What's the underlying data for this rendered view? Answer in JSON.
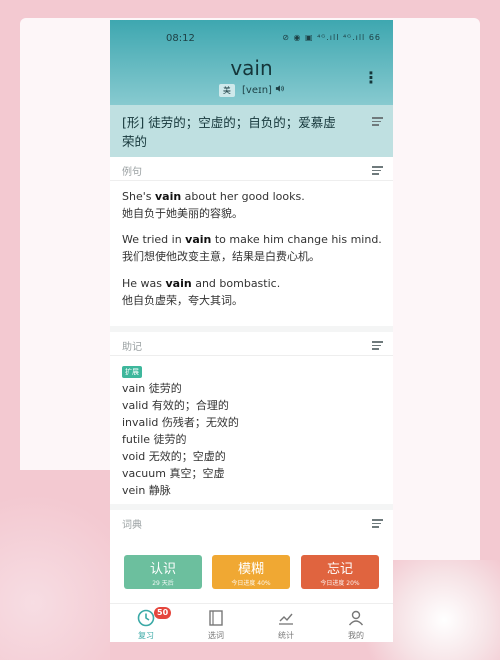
{
  "status": {
    "time": "08:12",
    "icons": "⊘ ◉ ▣ ⁴ᴳ.ıll ⁴ᴳ.ıll 66"
  },
  "word": {
    "text": "vain",
    "region": "美",
    "ipa": "[veɪn]",
    "audio_icon": "speaker-icon"
  },
  "definition": "[形] 徒劳的；空虚的；自负的；爱慕虚荣的",
  "examples": {
    "label": "例句",
    "items": [
      {
        "en_pre": "She's ",
        "en_word": "vain",
        "en_post": " about her good looks.",
        "zh": "她自负于她美丽的容貌。"
      },
      {
        "en_pre": "We tried in ",
        "en_word": "vain",
        "en_post": " to make him change his mind.",
        "zh": "我们想使他改变主意，结果是白费心机。"
      },
      {
        "en_pre": "He was ",
        "en_word": "vain",
        "en_post": " and bombastic.",
        "zh": "他自负虚荣，夸大其词。"
      }
    ]
  },
  "mnemonic": {
    "label": "助记",
    "badge": "扩展",
    "items": [
      "vain 徒劳的",
      "valid 有效的；合理的",
      "invalid 伤残者；无效的",
      "futile 徒劳的",
      "void 无效的；空虚的",
      "vacuum 真空；空虚",
      "vein 静脉"
    ]
  },
  "dictionary": {
    "label": "词典"
  },
  "buttons": [
    {
      "label": "认识",
      "sub": "29 天后",
      "color": "#6cbf9e"
    },
    {
      "label": "模糊",
      "sub": "今日进度 40%",
      "color": "#f0a833"
    },
    {
      "label": "忘记",
      "sub": "今日进度 20%",
      "color": "#e0643f"
    }
  ],
  "tabs": [
    {
      "label": "复习",
      "badge": "50",
      "icon": "clock-icon"
    },
    {
      "label": "选词",
      "icon": "book-icon"
    },
    {
      "label": "统计",
      "icon": "chart-icon"
    },
    {
      "label": "我的",
      "icon": "person-icon"
    }
  ],
  "colors": {
    "accent": "#3aa9a6",
    "badge": "#e5463d"
  }
}
